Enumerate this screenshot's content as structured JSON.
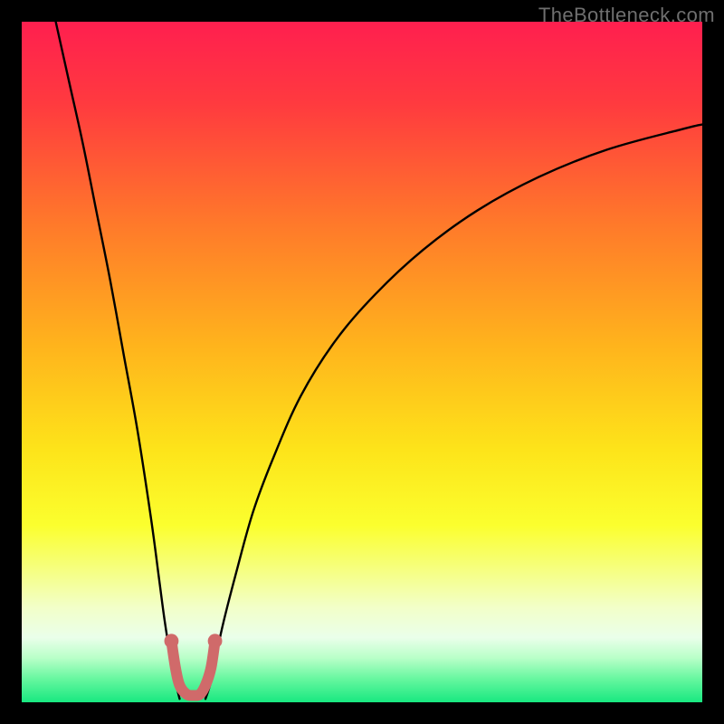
{
  "watermark": "TheBottleneck.com",
  "chart_data": {
    "type": "line",
    "title": "",
    "xlabel": "",
    "ylabel": "",
    "xlim": [
      0,
      100
    ],
    "ylim": [
      0,
      100
    ],
    "gradient_stops": [
      {
        "offset": 0,
        "color": "#ff1f4f"
      },
      {
        "offset": 0.12,
        "color": "#ff3a3f"
      },
      {
        "offset": 0.3,
        "color": "#ff7a2a"
      },
      {
        "offset": 0.48,
        "color": "#ffb51c"
      },
      {
        "offset": 0.63,
        "color": "#fde41a"
      },
      {
        "offset": 0.74,
        "color": "#fbff2e"
      },
      {
        "offset": 0.8,
        "color": "#f6ff7a"
      },
      {
        "offset": 0.86,
        "color": "#f2ffc8"
      },
      {
        "offset": 0.905,
        "color": "#eaffea"
      },
      {
        "offset": 0.935,
        "color": "#b8ffc8"
      },
      {
        "offset": 0.965,
        "color": "#68f7a0"
      },
      {
        "offset": 1.0,
        "color": "#18e880"
      }
    ],
    "series": [
      {
        "name": "left-branch",
        "x": [
          5,
          7,
          9,
          11,
          13,
          15,
          17,
          19,
          20.2,
          21.0,
          21.8,
          22.6,
          23.2
        ],
        "y": [
          100,
          91,
          82,
          72,
          62,
          51,
          40,
          27,
          18,
          12,
          7,
          3,
          0.5
        ]
      },
      {
        "name": "right-branch",
        "x": [
          27.0,
          27.8,
          28.6,
          29.7,
          31.5,
          34,
          37,
          41,
          46,
          52,
          59,
          67,
          76,
          86,
          97,
          100
        ],
        "y": [
          0.5,
          3,
          7,
          12,
          19,
          28,
          36,
          45,
          53,
          60,
          66.5,
          72.3,
          77.2,
          81.2,
          84.2,
          84.9
        ]
      },
      {
        "name": "valley-marker",
        "color": "#d06a6a",
        "points": [
          {
            "x": 22.0,
            "y": 9
          },
          {
            "x": 22.6,
            "y": 5
          },
          {
            "x": 23.2,
            "y": 2.5
          },
          {
            "x": 24.2,
            "y": 1.2
          },
          {
            "x": 25.2,
            "y": 1.0
          },
          {
            "x": 26.2,
            "y": 1.2
          },
          {
            "x": 27.0,
            "y": 2.5
          },
          {
            "x": 27.8,
            "y": 5
          },
          {
            "x": 28.4,
            "y": 9
          }
        ]
      }
    ]
  }
}
